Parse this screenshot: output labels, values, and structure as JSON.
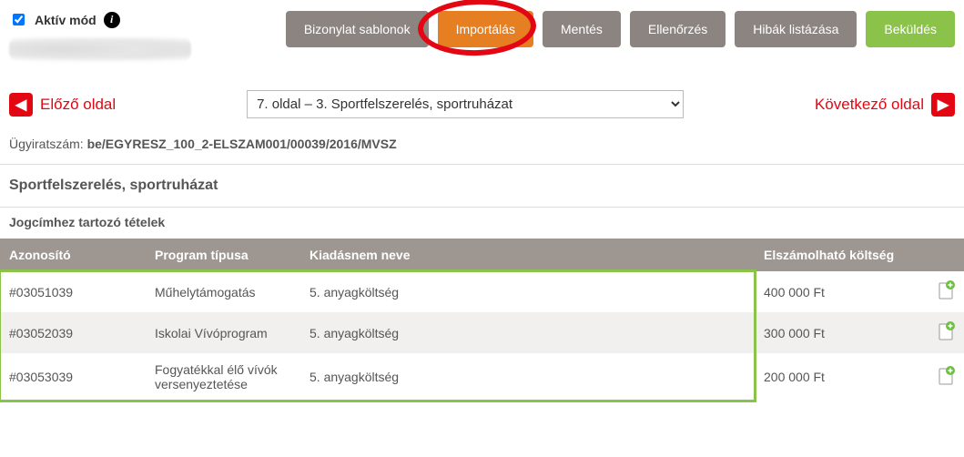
{
  "top": {
    "active_mode_label": "Aktív mód",
    "buttons": {
      "templates": "Bizonylat sablonok",
      "import": "Importálás",
      "save": "Mentés",
      "check": "Ellenőrzés",
      "errors": "Hibák listázása",
      "submit": "Beküldés"
    }
  },
  "pager": {
    "prev_label": "Előző oldal",
    "next_label": "Következő oldal",
    "select_value": "7. oldal – 3. Sportfelszerelés, sportruházat"
  },
  "file_ref": {
    "label": "Ügyiratszám: ",
    "value": "be/EGYRESZ_100_2-ELSZAM001/00039/2016/MVSZ"
  },
  "section": {
    "title": "Sportfelszerelés, sportruházat",
    "subtitle": "Jogcímhez tartozó tételek"
  },
  "table": {
    "headers": {
      "id": "Azonosító",
      "prog": "Program típusa",
      "kiad": "Kiadásnem neve",
      "cost": "Elszámolható költség"
    },
    "rows": [
      {
        "id": "#03051039",
        "prog": "Műhelytámogatás",
        "kiad": "5. anyagköltség",
        "cost": "400 000 Ft"
      },
      {
        "id": "#03052039",
        "prog": "Iskolai Vívóprogram",
        "kiad": "5. anyagköltség",
        "cost": "300 000 Ft"
      },
      {
        "id": "#03053039",
        "prog": "Fogyatékkal élő vívók versenyeztetése",
        "kiad": "5. anyagköltség",
        "cost": "200 000 Ft"
      }
    ]
  }
}
